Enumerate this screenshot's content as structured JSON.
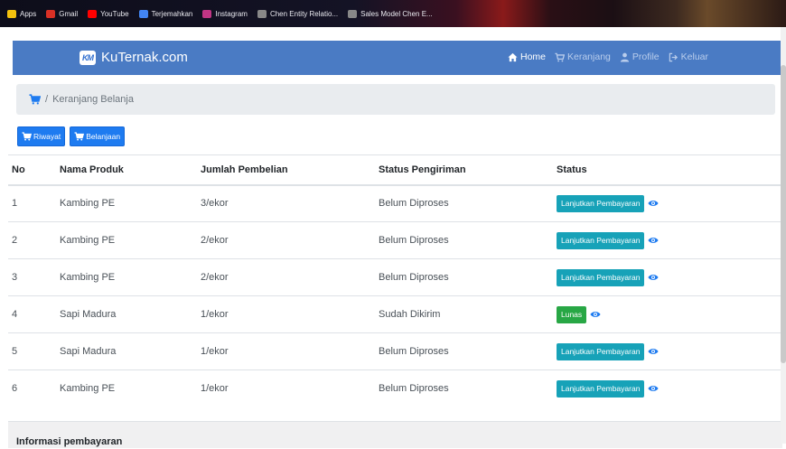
{
  "bookmarks": [
    {
      "label": "Apps",
      "icon": "apps-grid-icon",
      "color": "#f4c20d"
    },
    {
      "label": "Gmail",
      "icon": "gmail-icon",
      "color": "#d93025"
    },
    {
      "label": "YouTube",
      "icon": "youtube-icon",
      "color": "#ff0000"
    },
    {
      "label": "Terjemahkan",
      "icon": "translate-icon",
      "color": "#4285f4"
    },
    {
      "label": "Instagram",
      "icon": "instagram-icon",
      "color": "#c13584"
    },
    {
      "label": "Chen Entity Relatio...",
      "icon": "site-favicon-icon",
      "color": "#888888"
    },
    {
      "label": "Sales Model Chen E...",
      "icon": "site-favicon-icon",
      "color": "#888888"
    }
  ],
  "navbar": {
    "brand_logo": "KM",
    "brand": "KuTernak.com",
    "home": "Home",
    "cart": "Keranjang",
    "profile": "Profile",
    "logout": "Keluar"
  },
  "breadcrumb": {
    "separator": "/",
    "current": "Keranjang Belanja"
  },
  "buttons": {
    "history": "Riwayat",
    "shopping": "Belanjaan"
  },
  "table": {
    "headers": [
      "No",
      "Nama Produk",
      "Jumlah Pembelian",
      "Status Pengiriman",
      "Status"
    ],
    "rows": [
      {
        "no": "1",
        "product": "Kambing PE",
        "qty": "3/ekor",
        "shipping": "Belum Diproses",
        "status": "Lanjutkan Pembayaran",
        "paid": false
      },
      {
        "no": "2",
        "product": "Kambing PE",
        "qty": "2/ekor",
        "shipping": "Belum Diproses",
        "status": "Lanjutkan Pembayaran",
        "paid": false
      },
      {
        "no": "3",
        "product": "Kambing PE",
        "qty": "2/ekor",
        "shipping": "Belum Diproses",
        "status": "Lanjutkan Pembayaran",
        "paid": false
      },
      {
        "no": "4",
        "product": "Sapi Madura",
        "qty": "1/ekor",
        "shipping": "Sudah Dikirim",
        "status": "Lunas",
        "paid": true
      },
      {
        "no": "5",
        "product": "Sapi Madura",
        "qty": "1/ekor",
        "shipping": "Belum Diproses",
        "status": "Lanjutkan Pembayaran",
        "paid": false
      },
      {
        "no": "6",
        "product": "Kambing PE",
        "qty": "1/ekor",
        "shipping": "Belum Diproses",
        "status": "Lanjutkan Pembayaran",
        "paid": false
      }
    ]
  },
  "info": {
    "title": "Informasi pembayaran"
  },
  "colors": {
    "navbar": "#4a7bc4",
    "primary": "#1e7bf0",
    "info": "#17a2b8",
    "success": "#28a745"
  }
}
